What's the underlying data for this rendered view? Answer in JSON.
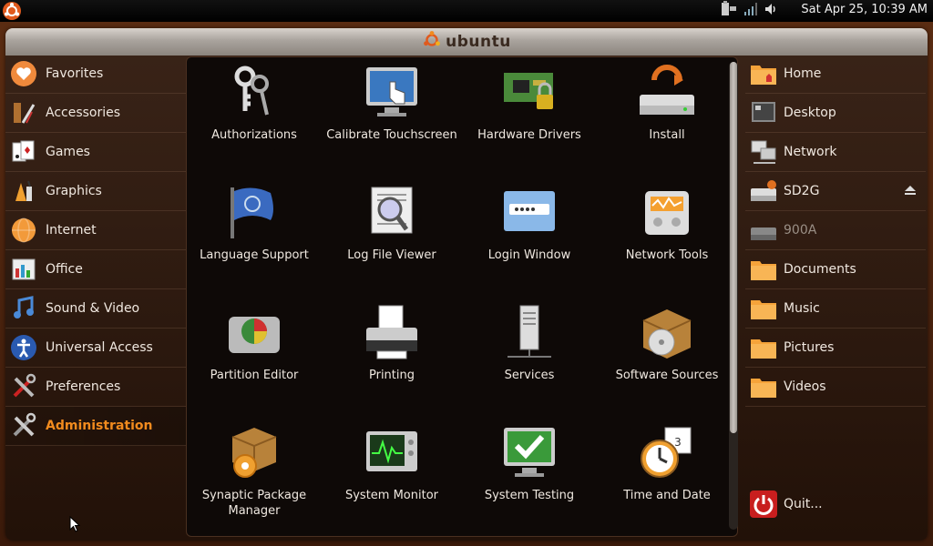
{
  "top_panel": {
    "clock": "Sat Apr 25, 10:39 AM"
  },
  "title": "ubuntu",
  "categories": [
    {
      "label": "Favorites",
      "icon": "heart-icon"
    },
    {
      "label": "Accessories",
      "icon": "accessories-icon"
    },
    {
      "label": "Games",
      "icon": "cards-icon"
    },
    {
      "label": "Graphics",
      "icon": "graphics-icon"
    },
    {
      "label": "Internet",
      "icon": "globe-icon"
    },
    {
      "label": "Office",
      "icon": "office-icon"
    },
    {
      "label": "Sound & Video",
      "icon": "music-icon"
    },
    {
      "label": "Universal Access",
      "icon": "accessibility-icon"
    },
    {
      "label": "Preferences",
      "icon": "preferences-icon"
    },
    {
      "label": "Administration",
      "icon": "administration-icon",
      "active": true
    }
  ],
  "apps": [
    {
      "label": "Authorizations",
      "icon": "keys-icon"
    },
    {
      "label": "Calibrate Touchscreen",
      "icon": "touchscreen-icon"
    },
    {
      "label": "Hardware Drivers",
      "icon": "hardware-drivers-icon"
    },
    {
      "label": "Install",
      "icon": "install-icon"
    },
    {
      "label": "Language Support",
      "icon": "flag-icon"
    },
    {
      "label": "Log File Viewer",
      "icon": "log-viewer-icon"
    },
    {
      "label": "Login Window",
      "icon": "login-window-icon"
    },
    {
      "label": "Network Tools",
      "icon": "network-tools-icon"
    },
    {
      "label": "Partition Editor",
      "icon": "partition-editor-icon"
    },
    {
      "label": "Printing",
      "icon": "printer-icon"
    },
    {
      "label": "Services",
      "icon": "server-icon"
    },
    {
      "label": "Software Sources",
      "icon": "software-sources-icon"
    },
    {
      "label": "Synaptic Package Manager",
      "icon": "package-icon"
    },
    {
      "label": "System Monitor",
      "icon": "system-monitor-icon"
    },
    {
      "label": "System Testing",
      "icon": "system-testing-icon"
    },
    {
      "label": "Time and Date",
      "icon": "clock-icon"
    }
  ],
  "places": [
    {
      "label": "Home",
      "icon": "home-folder-icon"
    },
    {
      "label": "Desktop",
      "icon": "desktop-icon"
    },
    {
      "label": "Network",
      "icon": "network-icon"
    },
    {
      "label": "SD2G",
      "icon": "drive-icon",
      "eject": true
    },
    {
      "label": "900A",
      "icon": "drive-icon",
      "disabled": true
    },
    {
      "label": "Documents",
      "icon": "folder-icon"
    },
    {
      "label": "Music",
      "icon": "folder-icon"
    },
    {
      "label": "Pictures",
      "icon": "folder-icon"
    },
    {
      "label": "Videos",
      "icon": "folder-icon"
    }
  ],
  "quit_label": "Quit...",
  "colors": {
    "accent": "#f28b1e",
    "panel_bg": "#0e0907",
    "folder": "#f5a33a"
  }
}
